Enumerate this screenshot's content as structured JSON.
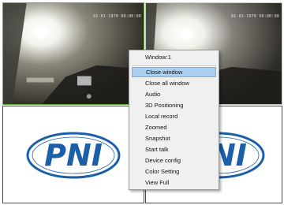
{
  "windows": [
    {
      "id": 1,
      "content": "camera-video",
      "osd_text": "01-01-1970 00:00:00",
      "selected": true
    },
    {
      "id": 2,
      "content": "camera-video",
      "osd_text": "01-01-1970 00:00:00",
      "selected": false
    },
    {
      "id": 3,
      "content": "logo",
      "logo_text": "PNI"
    },
    {
      "id": 4,
      "content": "logo",
      "logo_text": "PNI"
    }
  ],
  "colors": {
    "selection_border": "#63b23a",
    "logo_blue": "#1a5fa8",
    "menu_highlight": "#a9cff1"
  },
  "context_menu": {
    "title": "Window:1",
    "items": [
      {
        "label": "Close window",
        "highlighted": true
      },
      {
        "label": "Close all window"
      },
      {
        "label": "Audio"
      },
      {
        "label": "3D Positioning"
      },
      {
        "label": "Local record"
      },
      {
        "label": "Zoomed"
      },
      {
        "label": "Snapshot"
      },
      {
        "label": "Start talk"
      },
      {
        "label": "Device config"
      },
      {
        "label": "Color Setting"
      },
      {
        "label": "View Full"
      }
    ]
  }
}
